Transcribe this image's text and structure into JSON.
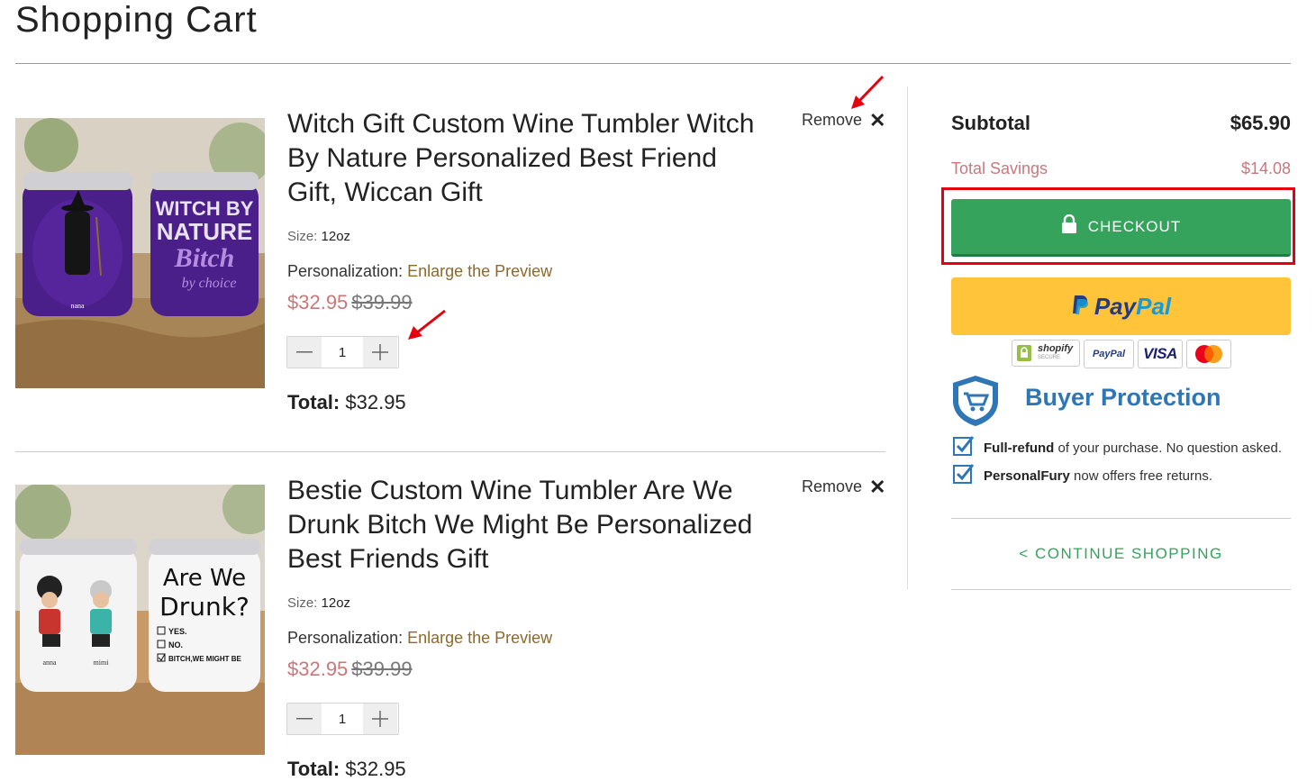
{
  "page": {
    "title": "Shopping Cart"
  },
  "items": [
    {
      "title": "Witch Gift Custom Wine Tumbler Witch By Nature Personalized Best Friend Gift, Wiccan Gift",
      "size_label": "Size:",
      "size_value": "12oz",
      "personalization_label": "Personalization:",
      "personalization_link": "Enlarge the Preview",
      "sale_price": "$32.95",
      "original_price": "$39.99",
      "quantity": "1",
      "total_label": "Total:",
      "total_value": "$32.95",
      "remove_label": "Remove",
      "image_text": {
        "line1": "WITCH BY",
        "line2": "NATURE",
        "line3": "Bitch",
        "line4": "by choice",
        "name": "nana"
      }
    },
    {
      "title": "Bestie Custom Wine Tumbler Are We Drunk Bitch We Might Be Personalized Best Friends Gift",
      "size_label": "Size:",
      "size_value": "12oz",
      "personalization_label": "Personalization:",
      "personalization_link": "Enlarge the Preview",
      "sale_price": "$32.95",
      "original_price": "$39.99",
      "quantity": "1",
      "total_label": "Total:",
      "total_value": "$32.95",
      "remove_label": "Remove",
      "image_text": {
        "line1": "Are We",
        "line2": "Drunk?",
        "opt1": "YES.",
        "opt2": "NO.",
        "opt3": "BITCH,WE MIGHT BE",
        "name1": "anna",
        "name2": "mimi"
      }
    }
  ],
  "summary": {
    "subtotal_label": "Subtotal",
    "subtotal_value": "$65.90",
    "savings_label": "Total Savings",
    "savings_value": "$14.08",
    "checkout_label": "CHECKOUT",
    "paypal_part1": "Pay",
    "paypal_part2": "Pal",
    "badges": [
      "shopify",
      "PayPal",
      "VISA",
      "mastercard"
    ],
    "shopify_badge_text": "shopify",
    "shopify_badge_sub": "SECURE",
    "buyer_protection_title": "Buyer Protection",
    "protection_lines": [
      {
        "bold": "Full-refund",
        "rest": "of your purchase. No question asked."
      },
      {
        "bold": "PersonalFury",
        "rest": "now offers free returns."
      }
    ],
    "continue_label": "< CONTINUE SHOPPING"
  },
  "colors": {
    "accent_green": "#35a35b",
    "sale_price": "#c9787a",
    "link_gold": "#8a6a2e",
    "paypal_yellow": "#ffc439",
    "protection_blue": "#2e76b6",
    "highlight_red": "#e5000f"
  },
  "icons": [
    "lock-icon",
    "close-icon",
    "minus-icon",
    "plus-icon",
    "checkbox-checked-icon",
    "shield-cart-icon",
    "annotation-arrow-icon"
  ]
}
